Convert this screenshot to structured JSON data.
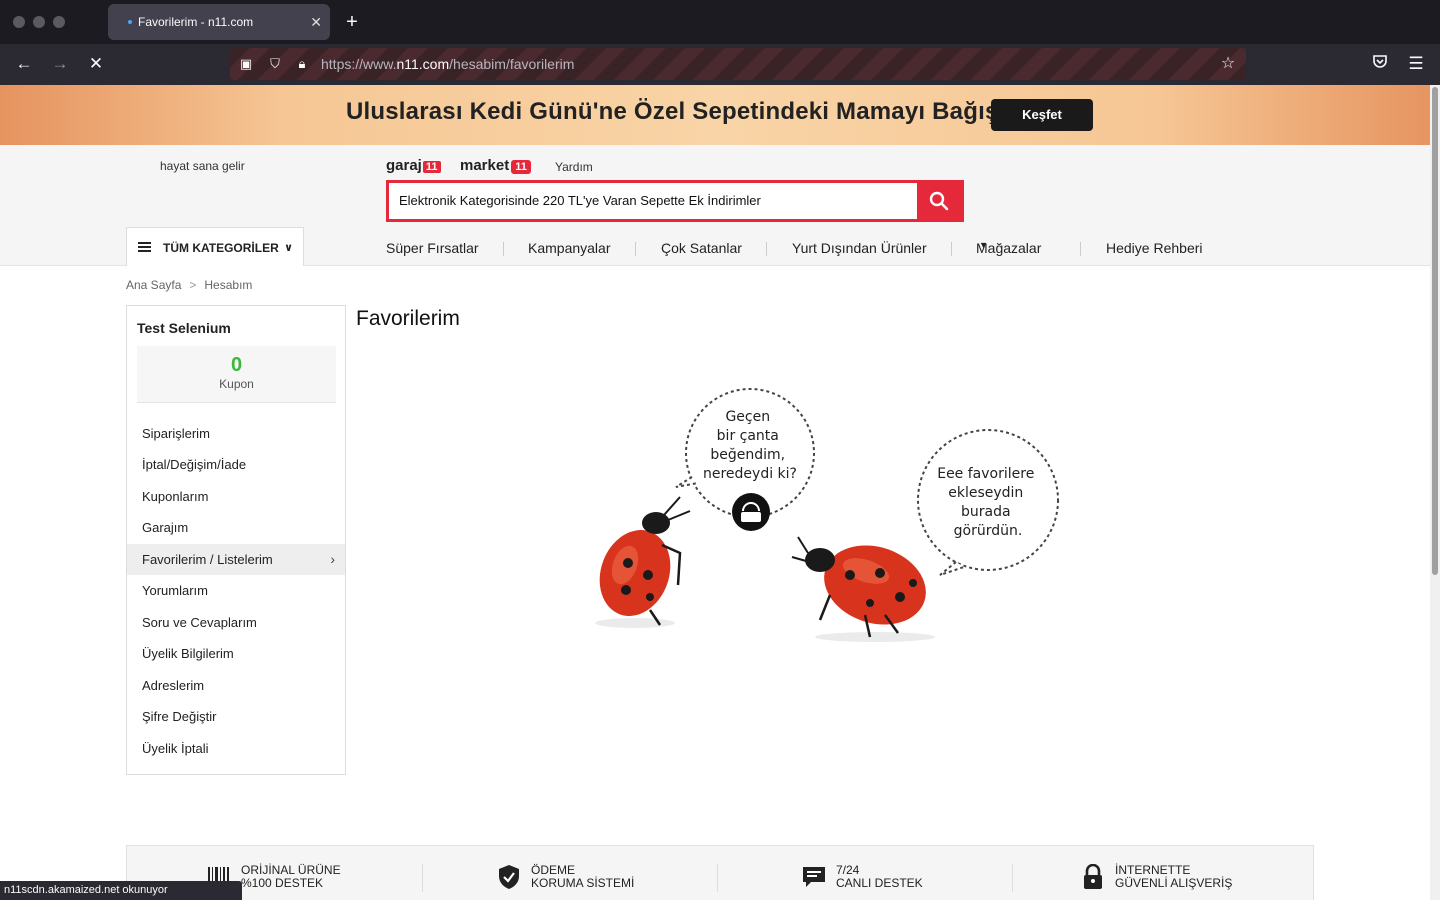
{
  "browser": {
    "tab_title": "Favorilerim - n11.com",
    "url_prefix": "https://www.",
    "url_host": "n11.com",
    "url_path": "/hesabim/favorilerim",
    "status_text": "n11scdn.akamaized.net okunuyor"
  },
  "promo": {
    "text": "Uluslarası Kedi Günü'ne Özel Sepetindeki Mamayı Bağışla",
    "button": "Keşfet"
  },
  "header": {
    "slogan": "hayat sana gelir",
    "garaj_logo": "garaj",
    "garaj_badge": "11",
    "market_logo": "market",
    "market_badge": "11",
    "help": "Yardım",
    "search_value": "Elektronik Kategorisinde 220 TL'ye Varan Sepette Ek İndirimler",
    "all_categories": "TÜM KATEGORİLER"
  },
  "menu": [
    "Süper Fırsatlar",
    "Kampanyalar",
    "Çok Satanlar",
    "Yurt Dışından Ürünler",
    "Mağazalar",
    "Hediye Rehberi"
  ],
  "breadcrumb": [
    "Ana Sayfa",
    "Hesabım"
  ],
  "sidebar": {
    "user": "Test Selenium",
    "coupon_count": "0",
    "coupon_label": "Kupon",
    "items": [
      "Siparişlerim",
      "İptal/Değişim/İade",
      "Kuponlarım",
      "Garajım",
      "Favorilerim / Listelerim",
      "Yorumlarım",
      "Soru ve Cevaplarım",
      "Üyelik Bilgilerim",
      "Adreslerim",
      "Şifre Değiştir",
      "Üyelik İptali"
    ],
    "active_index": 4
  },
  "main": {
    "title": "Favorilerim",
    "bubble_left": [
      "Geçen",
      "bir çanta",
      "beğendim,",
      "neredeydi ki?"
    ],
    "bubble_right": [
      "Eee favorilere",
      "ekleseydin",
      "burada",
      "görürdün."
    ]
  },
  "footer": {
    "features": [
      {
        "line1": "ORİJİNAL ÜRÜNE",
        "line2": "%100 DESTEK",
        "icon": "barcode-icon"
      },
      {
        "line1": "ÖDEME",
        "line2": "KORUMA SİSTEMİ",
        "icon": "shield-check-icon"
      },
      {
        "line1": "7/24",
        "line2": "CANLI DESTEK",
        "icon": "chat-icon"
      },
      {
        "line1": "İNTERNETTE",
        "line2": "GÜVENLİ ALIŞVERİŞ",
        "icon": "lock-icon"
      }
    ]
  },
  "colors": {
    "brand_red": "#e5283a",
    "coupon_green": "#3bb73b"
  }
}
